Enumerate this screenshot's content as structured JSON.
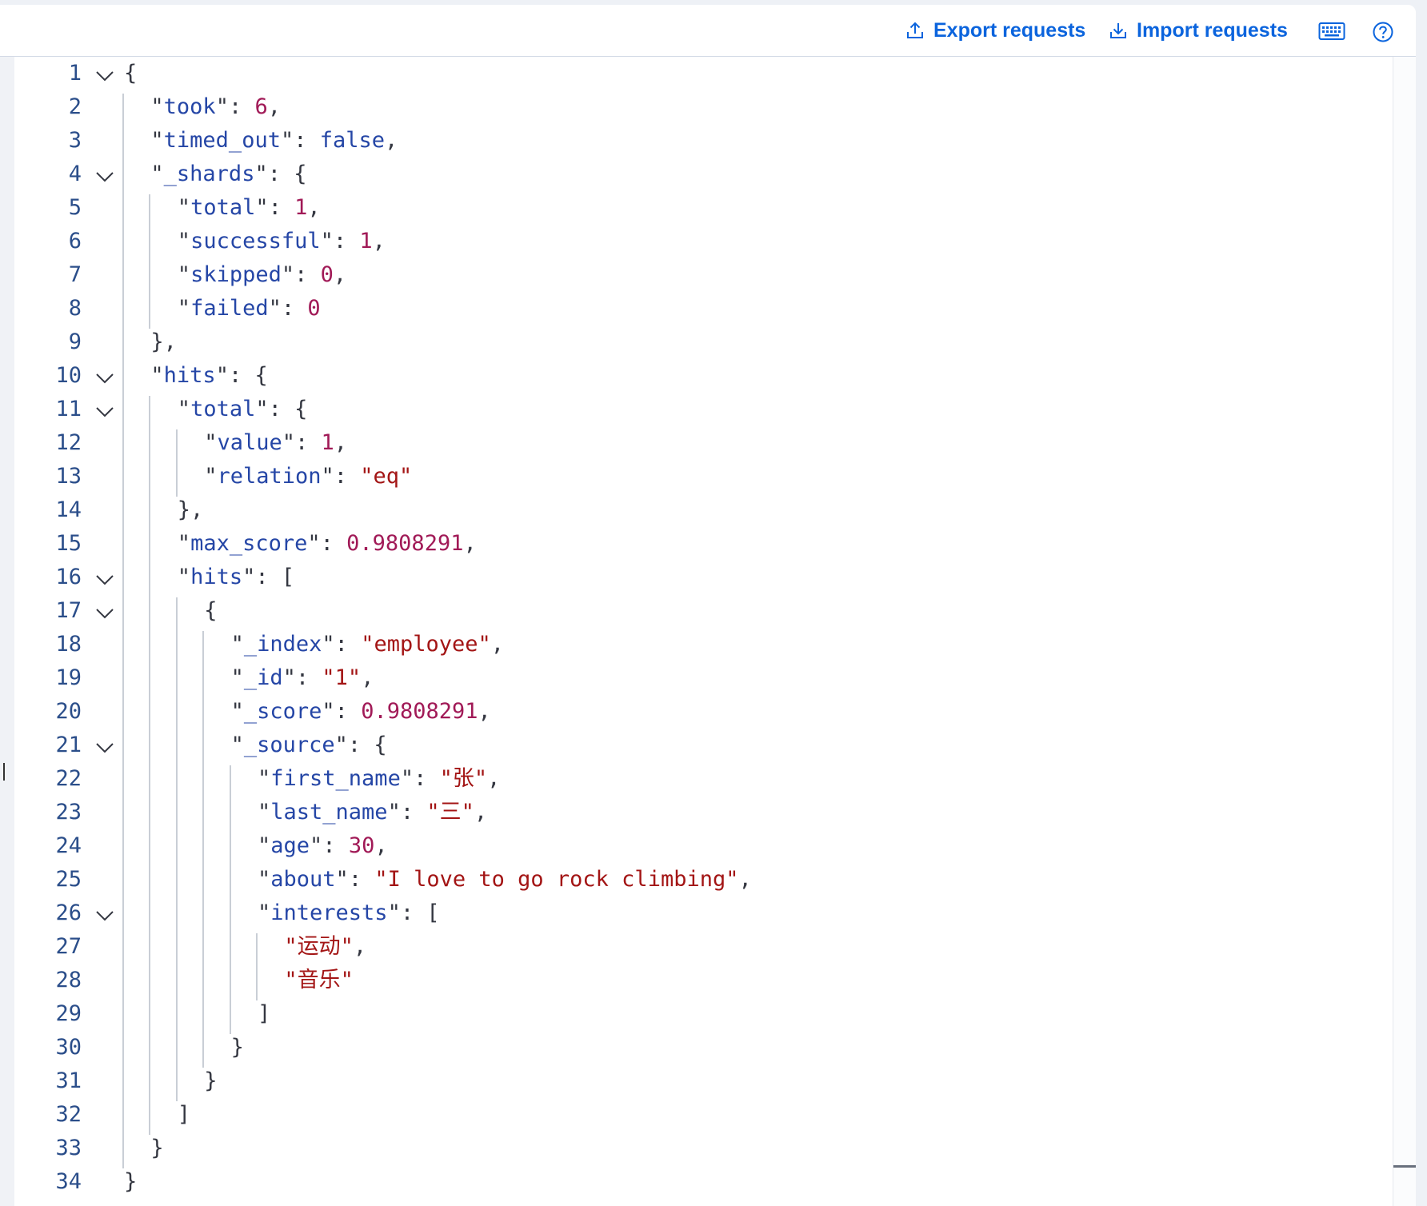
{
  "toolbar": {
    "export_label": "Export requests",
    "import_label": "Import requests",
    "export_icon": "upload-icon",
    "import_icon": "download-icon",
    "keyboard_icon": "keyboard-icon",
    "help_icon": "help-icon"
  },
  "colors": {
    "accent": "#0b64dd",
    "key": "#2546a6",
    "number": "#a11a57",
    "string": "#a31515",
    "line_number": "#2b4e8a"
  },
  "editor": {
    "lines": [
      {
        "n": "1",
        "indent": 0,
        "fold": true,
        "tokens": [
          [
            "p",
            "{"
          ]
        ]
      },
      {
        "n": "2",
        "indent": 1,
        "fold": false,
        "tokens": [
          [
            "q",
            "\""
          ],
          [
            "k",
            "took"
          ],
          [
            "q",
            "\""
          ],
          [
            "p",
            ": "
          ],
          [
            "n",
            "6"
          ],
          [
            "p",
            ","
          ]
        ]
      },
      {
        "n": "3",
        "indent": 1,
        "fold": false,
        "tokens": [
          [
            "q",
            "\""
          ],
          [
            "k",
            "timed_out"
          ],
          [
            "q",
            "\""
          ],
          [
            "p",
            ": "
          ],
          [
            "kw",
            "false"
          ],
          [
            "p",
            ","
          ]
        ]
      },
      {
        "n": "4",
        "indent": 1,
        "fold": true,
        "tokens": [
          [
            "q",
            "\""
          ],
          [
            "k",
            "_shards"
          ],
          [
            "q",
            "\""
          ],
          [
            "p",
            ": {"
          ]
        ]
      },
      {
        "n": "5",
        "indent": 2,
        "fold": false,
        "tokens": [
          [
            "q",
            "\""
          ],
          [
            "k",
            "total"
          ],
          [
            "q",
            "\""
          ],
          [
            "p",
            ": "
          ],
          [
            "n",
            "1"
          ],
          [
            "p",
            ","
          ]
        ]
      },
      {
        "n": "6",
        "indent": 2,
        "fold": false,
        "tokens": [
          [
            "q",
            "\""
          ],
          [
            "k",
            "successful"
          ],
          [
            "q",
            "\""
          ],
          [
            "p",
            ": "
          ],
          [
            "n",
            "1"
          ],
          [
            "p",
            ","
          ]
        ]
      },
      {
        "n": "7",
        "indent": 2,
        "fold": false,
        "tokens": [
          [
            "q",
            "\""
          ],
          [
            "k",
            "skipped"
          ],
          [
            "q",
            "\""
          ],
          [
            "p",
            ": "
          ],
          [
            "n",
            "0"
          ],
          [
            "p",
            ","
          ]
        ]
      },
      {
        "n": "8",
        "indent": 2,
        "fold": false,
        "tokens": [
          [
            "q",
            "\""
          ],
          [
            "k",
            "failed"
          ],
          [
            "q",
            "\""
          ],
          [
            "p",
            ": "
          ],
          [
            "n",
            "0"
          ]
        ]
      },
      {
        "n": "9",
        "indent": 1,
        "fold": false,
        "tokens": [
          [
            "p",
            "},"
          ]
        ]
      },
      {
        "n": "10",
        "indent": 1,
        "fold": true,
        "tokens": [
          [
            "q",
            "\""
          ],
          [
            "k",
            "hits"
          ],
          [
            "q",
            "\""
          ],
          [
            "p",
            ": {"
          ]
        ]
      },
      {
        "n": "11",
        "indent": 2,
        "fold": true,
        "tokens": [
          [
            "q",
            "\""
          ],
          [
            "k",
            "total"
          ],
          [
            "q",
            "\""
          ],
          [
            "p",
            ": {"
          ]
        ]
      },
      {
        "n": "12",
        "indent": 3,
        "fold": false,
        "tokens": [
          [
            "q",
            "\""
          ],
          [
            "k",
            "value"
          ],
          [
            "q",
            "\""
          ],
          [
            "p",
            ": "
          ],
          [
            "n",
            "1"
          ],
          [
            "p",
            ","
          ]
        ]
      },
      {
        "n": "13",
        "indent": 3,
        "fold": false,
        "tokens": [
          [
            "q",
            "\""
          ],
          [
            "k",
            "relation"
          ],
          [
            "q",
            "\""
          ],
          [
            "p",
            ": "
          ],
          [
            "s",
            "\"eq\""
          ]
        ]
      },
      {
        "n": "14",
        "indent": 2,
        "fold": false,
        "tokens": [
          [
            "p",
            "},"
          ]
        ]
      },
      {
        "n": "15",
        "indent": 2,
        "fold": false,
        "tokens": [
          [
            "q",
            "\""
          ],
          [
            "k",
            "max_score"
          ],
          [
            "q",
            "\""
          ],
          [
            "p",
            ": "
          ],
          [
            "n",
            "0.9808291"
          ],
          [
            "p",
            ","
          ]
        ]
      },
      {
        "n": "16",
        "indent": 2,
        "fold": true,
        "tokens": [
          [
            "q",
            "\""
          ],
          [
            "k",
            "hits"
          ],
          [
            "q",
            "\""
          ],
          [
            "p",
            ": ["
          ]
        ]
      },
      {
        "n": "17",
        "indent": 3,
        "fold": true,
        "tokens": [
          [
            "p",
            "{"
          ]
        ]
      },
      {
        "n": "18",
        "indent": 4,
        "fold": false,
        "tokens": [
          [
            "q",
            "\""
          ],
          [
            "k",
            "_index"
          ],
          [
            "q",
            "\""
          ],
          [
            "p",
            ": "
          ],
          [
            "s",
            "\"employee\""
          ],
          [
            "p",
            ","
          ]
        ]
      },
      {
        "n": "19",
        "indent": 4,
        "fold": false,
        "tokens": [
          [
            "q",
            "\""
          ],
          [
            "k",
            "_id"
          ],
          [
            "q",
            "\""
          ],
          [
            "p",
            ": "
          ],
          [
            "s",
            "\"1\""
          ],
          [
            "p",
            ","
          ]
        ]
      },
      {
        "n": "20",
        "indent": 4,
        "fold": false,
        "tokens": [
          [
            "q",
            "\""
          ],
          [
            "k",
            "_score"
          ],
          [
            "q",
            "\""
          ],
          [
            "p",
            ": "
          ],
          [
            "n",
            "0.9808291"
          ],
          [
            "p",
            ","
          ]
        ]
      },
      {
        "n": "21",
        "indent": 4,
        "fold": true,
        "tokens": [
          [
            "q",
            "\""
          ],
          [
            "k",
            "_source"
          ],
          [
            "q",
            "\""
          ],
          [
            "p",
            ": {"
          ]
        ]
      },
      {
        "n": "22",
        "indent": 5,
        "fold": false,
        "tokens": [
          [
            "q",
            "\""
          ],
          [
            "k",
            "first_name"
          ],
          [
            "q",
            "\""
          ],
          [
            "p",
            ": "
          ],
          [
            "s",
            "\"张\""
          ],
          [
            "p",
            ","
          ]
        ]
      },
      {
        "n": "23",
        "indent": 5,
        "fold": false,
        "tokens": [
          [
            "q",
            "\""
          ],
          [
            "k",
            "last_name"
          ],
          [
            "q",
            "\""
          ],
          [
            "p",
            ": "
          ],
          [
            "s",
            "\"三\""
          ],
          [
            "p",
            ","
          ]
        ]
      },
      {
        "n": "24",
        "indent": 5,
        "fold": false,
        "tokens": [
          [
            "q",
            "\""
          ],
          [
            "k",
            "age"
          ],
          [
            "q",
            "\""
          ],
          [
            "p",
            ": "
          ],
          [
            "n",
            "30"
          ],
          [
            "p",
            ","
          ]
        ]
      },
      {
        "n": "25",
        "indent": 5,
        "fold": false,
        "tokens": [
          [
            "q",
            "\""
          ],
          [
            "k",
            "about"
          ],
          [
            "q",
            "\""
          ],
          [
            "p",
            ": "
          ],
          [
            "s",
            "\"I love to go rock climbing\""
          ],
          [
            "p",
            ","
          ]
        ]
      },
      {
        "n": "26",
        "indent": 5,
        "fold": true,
        "tokens": [
          [
            "q",
            "\""
          ],
          [
            "k",
            "interests"
          ],
          [
            "q",
            "\""
          ],
          [
            "p",
            ": ["
          ]
        ]
      },
      {
        "n": "27",
        "indent": 6,
        "fold": false,
        "tokens": [
          [
            "s",
            "\"运动\""
          ],
          [
            "p",
            ","
          ]
        ]
      },
      {
        "n": "28",
        "indent": 6,
        "fold": false,
        "tokens": [
          [
            "s",
            "\"音乐\""
          ]
        ]
      },
      {
        "n": "29",
        "indent": 5,
        "fold": false,
        "tokens": [
          [
            "p",
            "]"
          ]
        ]
      },
      {
        "n": "30",
        "indent": 4,
        "fold": false,
        "tokens": [
          [
            "p",
            "}"
          ]
        ]
      },
      {
        "n": "31",
        "indent": 3,
        "fold": false,
        "tokens": [
          [
            "p",
            "}"
          ]
        ]
      },
      {
        "n": "32",
        "indent": 2,
        "fold": false,
        "tokens": [
          [
            "p",
            "]"
          ]
        ]
      },
      {
        "n": "33",
        "indent": 1,
        "fold": false,
        "tokens": [
          [
            "p",
            "}"
          ]
        ]
      },
      {
        "n": "34",
        "indent": 0,
        "fold": false,
        "tokens": [
          [
            "p",
            "}"
          ]
        ]
      }
    ]
  }
}
